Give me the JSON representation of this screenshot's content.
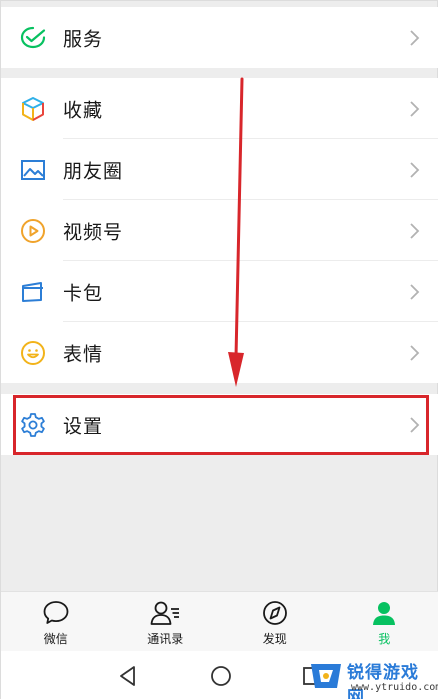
{
  "menu": {
    "service": {
      "label": "服务",
      "icon": "wechat-pay-icon"
    },
    "favorites": {
      "label": "收藏",
      "icon": "cube-icon"
    },
    "moments": {
      "label": "朋友圈",
      "icon": "image-icon"
    },
    "channels": {
      "label": "视频号",
      "icon": "play-icon"
    },
    "cards": {
      "label": "卡包",
      "icon": "card-icon"
    },
    "stickers": {
      "label": "表情",
      "icon": "smile-icon"
    },
    "settings": {
      "label": "设置",
      "icon": "gear-icon"
    }
  },
  "tabbar": {
    "tabs": [
      {
        "label": "微信",
        "icon": "chat-bubble-icon"
      },
      {
        "label": "通讯录",
        "icon": "contacts-icon"
      },
      {
        "label": "发现",
        "icon": "compass-icon"
      },
      {
        "label": "我",
        "icon": "person-icon",
        "active": true
      }
    ]
  },
  "watermark": {
    "title": "锐得游戏网",
    "url": "www.ytruido.com"
  },
  "colors": {
    "accent": "#07c160",
    "highlight_box": "#d8262b",
    "arrow": "#d8262b",
    "background": "#ededed"
  }
}
